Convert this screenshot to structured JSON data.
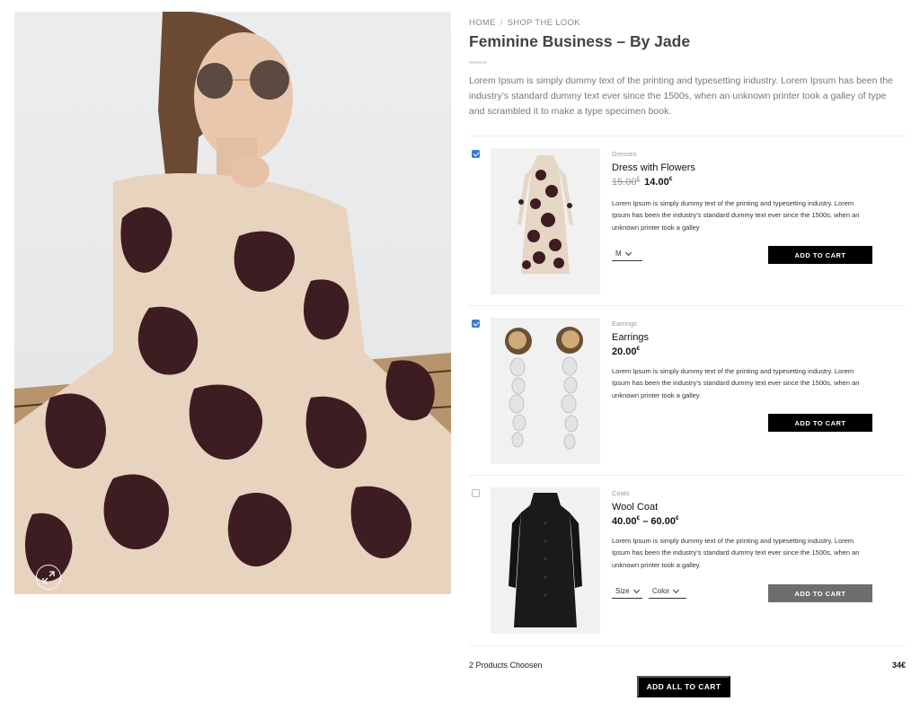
{
  "breadcrumb": {
    "home": "HOME",
    "separator": "/",
    "current": "SHOP THE LOOK"
  },
  "page": {
    "title": "Feminine Business – By Jade",
    "intro": "Lorem Ipsum is simply dummy text of the printing and typesetting industry. Lorem Ipsum has been the industry’s standard dummy text ever since the 1500s, when an unknown printer took a galley of type and scrambled it to make a type specimen book."
  },
  "hero": {
    "zoom_icon": "expand-icon"
  },
  "products": [
    {
      "checked": true,
      "category": "Dresses",
      "name": "Dress with Flowers",
      "old_price": "15.00",
      "price": "14.00",
      "currency": "€",
      "description": "Lorem Ipsum is simply dummy text of the printing and typesetting industry. Lorem Ipsum has been the industry’s standard dummy text ever since the 1500s, when an unknown printer took a galley",
      "size_selected": "M",
      "button": "ADD TO CART"
    },
    {
      "checked": true,
      "category": "Earrings",
      "name": "Earrings",
      "price": "20.00",
      "currency": "€",
      "description": "Lorem Ipsum is simply dummy text of the printing and typesetting industry. Lorem Ipsum has been the industry’s standard dummy text ever since the 1500s, when an unknown printer took a galley.",
      "button": "ADD TO CART"
    },
    {
      "checked": false,
      "category": "Coats",
      "name": "Wool Coat",
      "price_from": "40.00",
      "price_to": "60.00",
      "price_sep": "–",
      "currency": "€",
      "description": "Lorem Ipsum is simply dummy text of the printing and typesetting industry. Lorem Ipsum has been the industry’s standard dummy text ever since the 1500s, when an unknown printer took a galley.",
      "size_placeholder": "Size",
      "color_placeholder": "Color",
      "button": "ADD TO CART"
    }
  ],
  "footer": {
    "chosen_label": "2 Products Choosen",
    "total": "34€",
    "add_all_button": "ADD ALL TO CART"
  },
  "colors": {
    "accent_check": "#3a7bd5",
    "button": "#000000",
    "button_disabled": "#6e6e6e",
    "title": "#444444"
  }
}
